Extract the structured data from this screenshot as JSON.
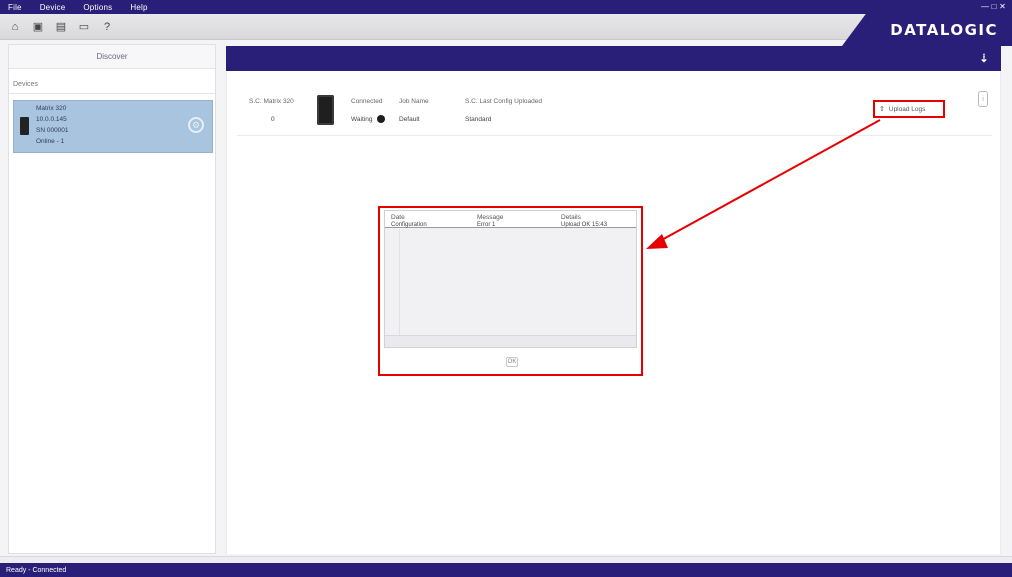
{
  "menubar": {
    "items": [
      "File",
      "Device",
      "Options",
      "Help"
    ],
    "window_controls": "— □ ✕"
  },
  "toolbar": {
    "icons": [
      "home-icon",
      "save-icon",
      "open-icon",
      "monitor-icon",
      "help-icon"
    ],
    "home_glyph": "⌂",
    "save_glyph": "▣",
    "open_glyph": "▤",
    "monitor_glyph": "▭",
    "help_glyph": "?"
  },
  "brand": {
    "logo_text": "DATALOGIC",
    "color": "#2a1f78"
  },
  "left_panel": {
    "discover_label": "Discover",
    "devices_label": "Devices",
    "device": {
      "line1": "Matrix 320",
      "line2": "10.0.0.145",
      "line3": "SN 000001",
      "line4": "Online - 1"
    },
    "settings_glyph": "⚙"
  },
  "header": {
    "icon_glyph": "⇣"
  },
  "device_info": {
    "col1_label": "S.C. Matrix 320",
    "col1_value": "0",
    "col2_label": "Connected",
    "col2_value": "Waiting",
    "col3_label": "Job Name",
    "col3_value": "Default",
    "col4_label": "S.C. Last Config Uploaded",
    "col4_value": "Standard",
    "upload_label": "Upload Logs",
    "upload_glyph": "⇧",
    "info_glyph": "i"
  },
  "dialog": {
    "col_headers": [
      "Date",
      "Message",
      "Details"
    ],
    "row": [
      "Configuration",
      "Error 1",
      "Upload OK 15:43"
    ],
    "ok_label": "OK"
  },
  "statusbar": {
    "text": "Ready - Connected"
  }
}
